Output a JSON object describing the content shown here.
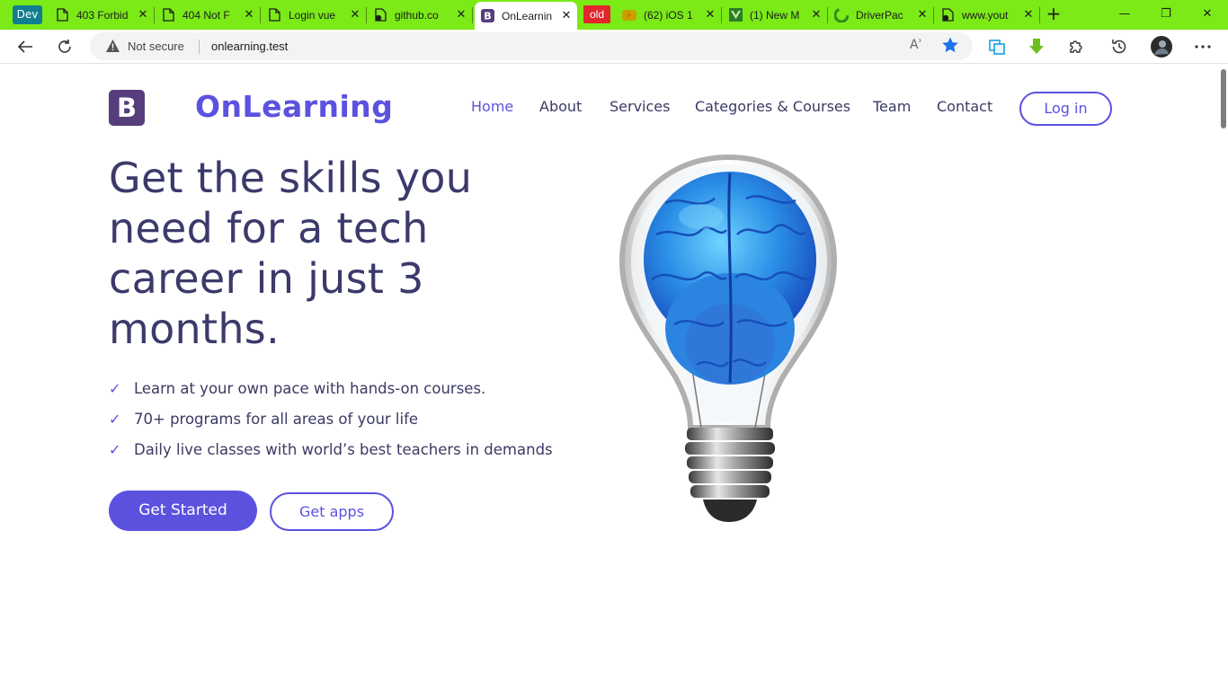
{
  "browser": {
    "profile_label": "Dev",
    "tabs": [
      {
        "title": "403 Forbid",
        "icon": "page-icon"
      },
      {
        "title": "404 Not F",
        "icon": "page-icon"
      },
      {
        "title": "Login vue",
        "icon": "page-icon"
      },
      {
        "title": "github.co",
        "icon": "github-icon"
      },
      {
        "title": "OnLearnin",
        "icon": "bootstrap-icon",
        "active": true
      },
      {
        "title": "(62) iOS 1",
        "icon": "youtube-icon"
      },
      {
        "title": "(1) New M",
        "icon": "vue-icon"
      },
      {
        "title": "DriverPac",
        "icon": "driverpack-icon"
      },
      {
        "title": "www.yout",
        "icon": "github-icon"
      }
    ],
    "old_badge": "old",
    "new_tab_symbol": "+",
    "window_controls": {
      "minimize": "—",
      "restore": "❐",
      "close": "✕"
    },
    "address": {
      "security_label": "Not secure",
      "url": "onlearning.test",
      "read_aloud": "Aʾ"
    },
    "accent_color": "#7bea17"
  },
  "site": {
    "logo_letter": "B",
    "brand": "OnLearning",
    "brand_color": "#5b52e0",
    "nav": {
      "home": "Home",
      "about": "About",
      "services": "Services",
      "categories": "Categories & Courses",
      "team": "Team",
      "contact": "Contact"
    },
    "login_label": "Log in",
    "hero": {
      "title": "Get the skills you need for a tech career in just 3 months.",
      "features": [
        "Learn at your own pace with hands-on courses.",
        "70+ programs for all areas of your life",
        "Daily live classes with world’s best teachers in demands"
      ],
      "primary_cta": "Get Started",
      "secondary_cta": "Get apps",
      "image": "lightbulb-brain-illustration"
    }
  }
}
